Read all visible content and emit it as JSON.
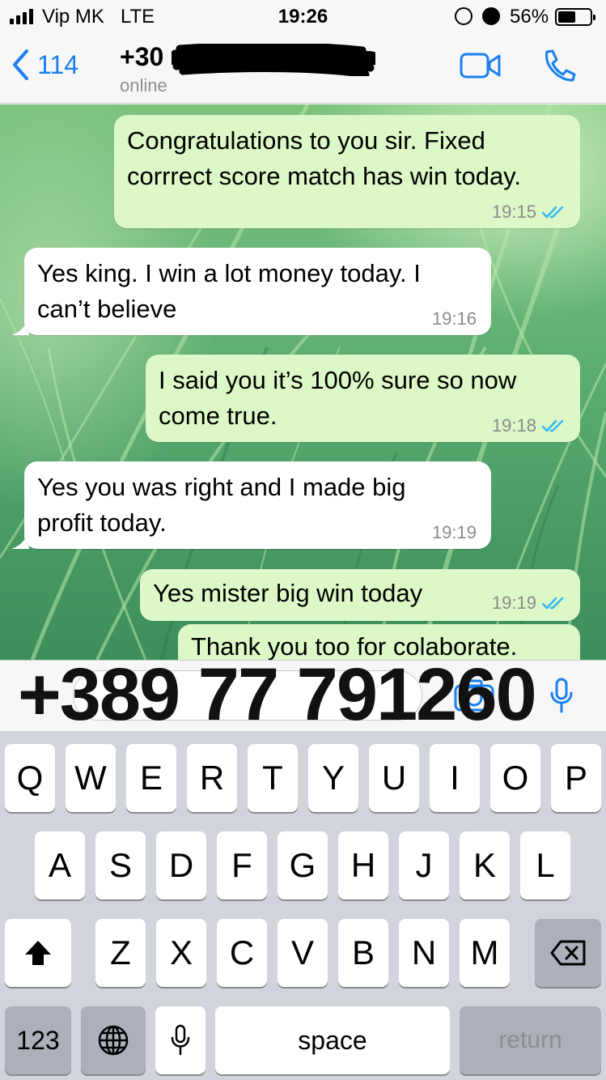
{
  "status_bar": {
    "carrier": "Vip MK",
    "network": "LTE",
    "time": "19:26",
    "battery": "56%",
    "battery_level": 0.56
  },
  "header": {
    "back_count": "114",
    "contact_name": "+30",
    "contact_status": "online",
    "accent": "#1a80f0"
  },
  "messages": [
    {
      "direction": "out",
      "text_1": "Congratulations to you sir. Fixed",
      "text_2": "corrrect score match has win today.",
      "time": "19:15",
      "read": true
    },
    {
      "direction": "in",
      "text_1": "Yes king. I win a lot money today. I",
      "text_2": "can’t believe",
      "time": "19:16"
    },
    {
      "direction": "out",
      "text_1": "I said you it’s 100% sure so now",
      "text_2": "come true.",
      "time": "19:18",
      "read": true
    },
    {
      "direction": "in",
      "text_1": "Yes you was right and I made big",
      "text_2": "profit today.",
      "time": "19:19"
    },
    {
      "direction": "out",
      "text_1": "Yes mister big win today",
      "time": "19:19",
      "read": true
    },
    {
      "direction": "out",
      "text_1": "Thank you too for colaborate."
    }
  ],
  "overlay_phone": "+389 77 791260",
  "keyboard": {
    "row1": [
      "Q",
      "W",
      "E",
      "R",
      "T",
      "Y",
      "U",
      "I",
      "O",
      "P"
    ],
    "row2": [
      "A",
      "S",
      "D",
      "F",
      "G",
      "H",
      "J",
      "K",
      "L"
    ],
    "row3": [
      "Z",
      "X",
      "C",
      "V",
      "B",
      "N",
      "M"
    ],
    "numbers_key": "123",
    "space_key": "space",
    "return_key": "return"
  }
}
